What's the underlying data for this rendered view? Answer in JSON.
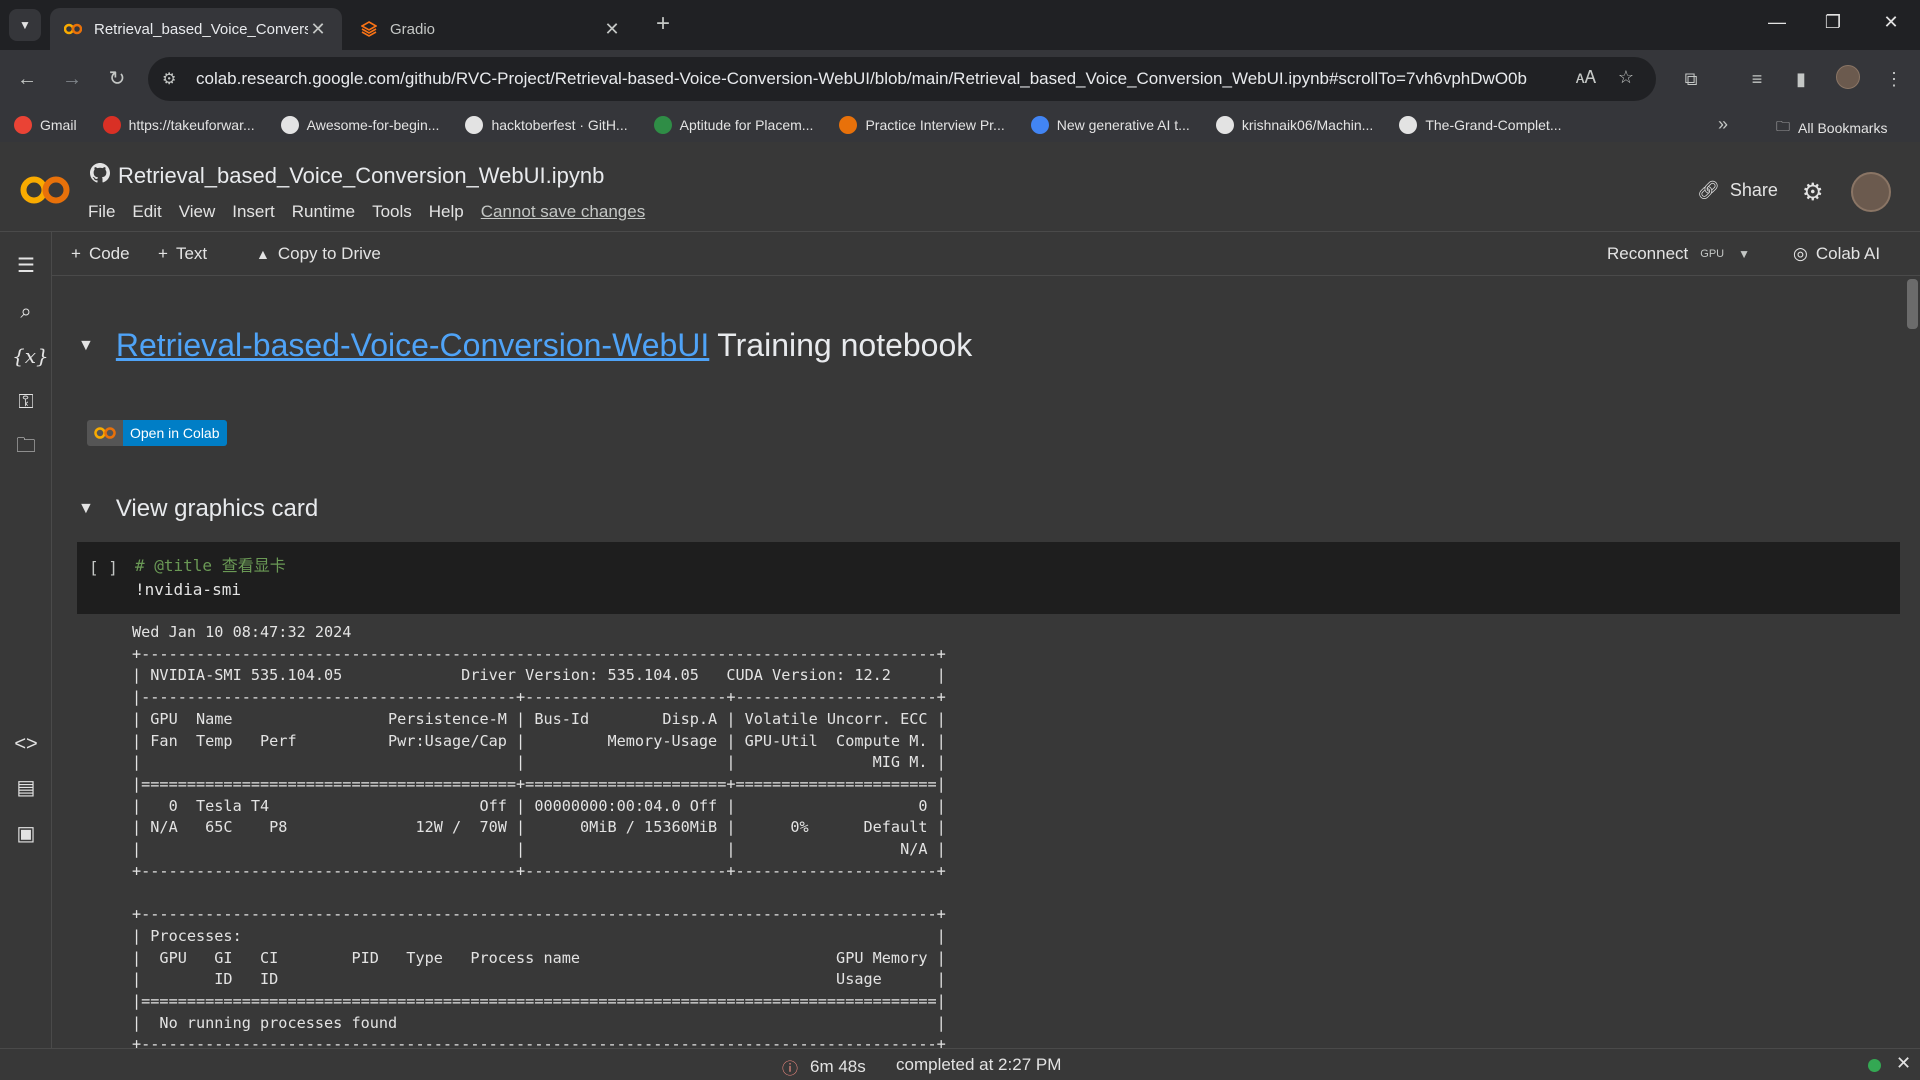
{
  "browser": {
    "tabs": [
      {
        "title": "Retrieval_based_Voice_Conversi",
        "active": true
      },
      {
        "title": "Gradio",
        "active": false
      }
    ],
    "url": "colab.research.google.com/github/RVC-Project/Retrieval-based-Voice-Conversion-WebUI/blob/main/Retrieval_based_Voice_Conversion_WebUI.ipynb#scrollTo=7vh6vphDwO0b",
    "bookmarks": [
      {
        "label": "Gmail",
        "icon": "gmail-icon",
        "color": "#ea4335"
      },
      {
        "label": "https://takeuforwar...",
        "icon": "tuf-icon",
        "color": "#d93025"
      },
      {
        "label": "Awesome-for-begin...",
        "icon": "github-icon",
        "color": "#e3e3e3"
      },
      {
        "label": "hacktoberfest · GitH...",
        "icon": "github-icon",
        "color": "#e3e3e3"
      },
      {
        "label": "Aptitude for Placem...",
        "icon": "gfg-icon",
        "color": "#2f8d46"
      },
      {
        "label": "Practice Interview Pr...",
        "icon": "interview-icon",
        "color": "#e8710a"
      },
      {
        "label": "New generative AI t...",
        "icon": "google-cloud-icon",
        "color": "#4285f4"
      },
      {
        "label": "krishnaik06/Machin...",
        "icon": "github-icon",
        "color": "#e3e3e3"
      },
      {
        "label": "The-Grand-Complet...",
        "icon": "github-icon",
        "color": "#e3e3e3"
      }
    ],
    "all_bookmarks": "All Bookmarks"
  },
  "colab": {
    "notebook_title": "Retrieval_based_Voice_Conversion_WebUI.ipynb",
    "menu": [
      "File",
      "Edit",
      "View",
      "Insert",
      "Runtime",
      "Tools",
      "Help"
    ],
    "menu_warning": "Cannot save changes",
    "share_label": "Share",
    "toolbar": {
      "code_label": "Code",
      "text_label": "Text",
      "copy_label": "Copy to Drive",
      "reconnect_label": "Reconnect",
      "gpu_label": "GPU",
      "colab_ai_label": "Colab AI"
    }
  },
  "notebook": {
    "heading_link": "Retrieval-based-Voice-Conversion-WebUI",
    "heading_rest": "Training notebook",
    "badge_label": "Open in Colab",
    "section_title": "View graphics card",
    "cell": {
      "run_bracket": "[ ]",
      "comment": "# @title 查看显卡",
      "command": "!nvidia-smi"
    },
    "output_lines": [
      "Wed Jan 10 08:47:32 2024",
      "+---------------------------------------------------------------------------------------+",
      "| NVIDIA-SMI 535.104.05             Driver Version: 535.104.05   CUDA Version: 12.2     |",
      "|-----------------------------------------+----------------------+----------------------+",
      "| GPU  Name                 Persistence-M | Bus-Id        Disp.A | Volatile Uncorr. ECC |",
      "| Fan  Temp   Perf          Pwr:Usage/Cap |         Memory-Usage | GPU-Util  Compute M. |",
      "|                                         |                      |               MIG M. |",
      "|=========================================+======================+======================|",
      "|   0  Tesla T4                       Off | 00000000:00:04.0 Off |                    0 |",
      "| N/A   65C    P8              12W /  70W |      0MiB / 15360MiB |      0%      Default |",
      "|                                         |                      |                  N/A |",
      "+-----------------------------------------+----------------------+----------------------+",
      "",
      "+---------------------------------------------------------------------------------------+",
      "| Processes:                                                                            |",
      "|  GPU   GI   CI        PID   Type   Process name                            GPU Memory |",
      "|        ID   ID                                                             Usage      |",
      "|=======================================================================================|",
      "|  No running processes found                                                           |",
      "+---------------------------------------------------------------------------------------+"
    ]
  },
  "status": {
    "elapsed": "6m 48s",
    "completed": "completed at 2:27 PM"
  }
}
